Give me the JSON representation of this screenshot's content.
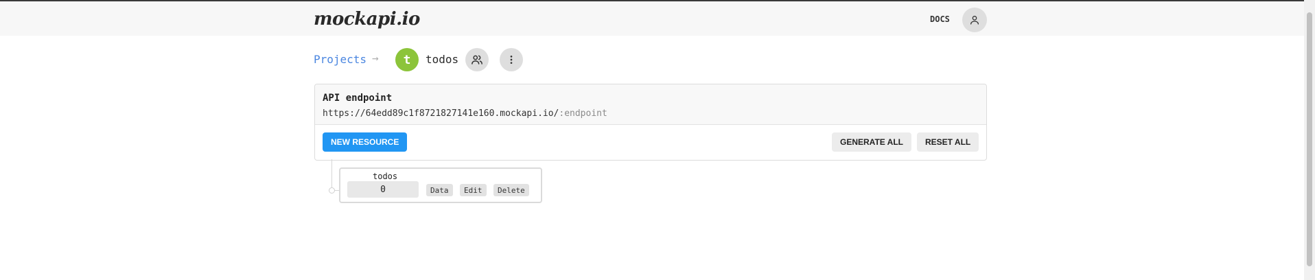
{
  "app": {
    "logo": "mockapi.io"
  },
  "header": {
    "docs_label": "DOCS",
    "user_icon": "user-icon"
  },
  "breadcrumb": {
    "projects_label": "Projects",
    "arrow": "→",
    "avatar_letter": "t",
    "project_name": "todos",
    "avatar_color": "#8cc43a",
    "members_icon": "users-icon",
    "menu_icon": "more-vertical-icon"
  },
  "api_card": {
    "title": "API endpoint",
    "url_base": "https://64edd89c1f8721827141e160.mockapi.io/",
    "url_suffix": ":endpoint",
    "new_resource_label": "NEW RESOURCE",
    "generate_all_label": "GENERATE ALL",
    "reset_all_label": "RESET ALL",
    "accent_color": "#2196f3"
  },
  "resources": [
    {
      "name": "todos",
      "count": "0",
      "data_label": "Data",
      "edit_label": "Edit",
      "delete_label": "Delete"
    }
  ]
}
